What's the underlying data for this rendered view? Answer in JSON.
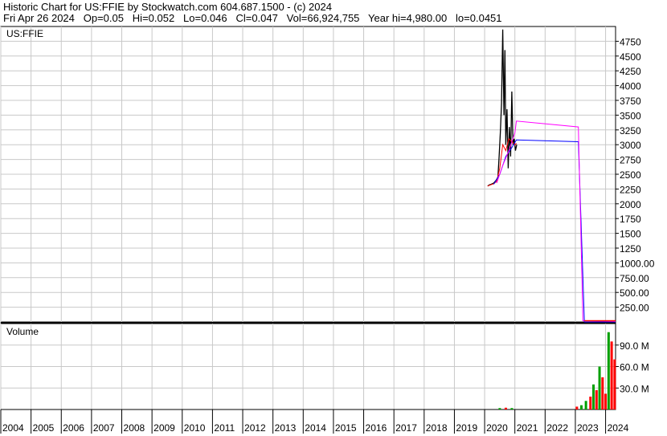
{
  "header": {
    "line1": "Historic Chart for US:FFIE by Stockwatch.com 604.687.1500 - (c) 2024",
    "line2": "Fri Apr 26 2024   Op=0.05   Hi=0.052   Lo=0.046   Cl=0.047   Vol=66,924,755   Year hi=4,980.00   lo=0.0451"
  },
  "chart_data": [
    {
      "type": "line",
      "title": "US:FFIE",
      "ylim": [
        0,
        5000
      ],
      "xlim": [
        2004,
        2024.33
      ],
      "y_ticks": [
        "250.00",
        "500.00",
        "750.00",
        "1000.00",
        "1250",
        "1500",
        "1750",
        "2000",
        "2250",
        "2500",
        "2750",
        "3000",
        "3250",
        "3500",
        "3750",
        "4000",
        "4250",
        "4500",
        "4750"
      ],
      "y_tick_values": [
        250,
        500,
        750,
        1000,
        1250,
        1500,
        1750,
        2000,
        2250,
        2500,
        2750,
        3000,
        3250,
        3500,
        3750,
        4000,
        4250,
        4500,
        4750
      ],
      "x_ticks": [
        "2004",
        "2005",
        "2006",
        "2007",
        "2008",
        "2009",
        "2010",
        "2011",
        "2012",
        "2013",
        "2014",
        "2015",
        "2016",
        "2017",
        "2018",
        "2019",
        "2020",
        "2021",
        "2022",
        "2023",
        "2024"
      ],
      "grid": true,
      "colors": {
        "price": "#000000",
        "ma_short": "#ff0000",
        "ma_mid": "#0000ff",
        "ma_long": "#ff00ff",
        "grid": "#c8c8c8"
      },
      "series": [
        {
          "color": "#000000",
          "x": [
            2020.1,
            2020.16,
            2020.22,
            2020.3,
            2020.38,
            2020.44,
            2020.48,
            2020.52,
            2020.56,
            2020.6,
            2020.64,
            2020.67,
            2020.7,
            2020.74,
            2020.78,
            2020.82,
            2020.86,
            2020.9,
            2020.94,
            2020.98,
            2021.02,
            2021.06
          ],
          "y": [
            2300,
            2320,
            2330,
            2350,
            2400,
            2450,
            2800,
            3200,
            3700,
            4950,
            3500,
            4600,
            3000,
            3600,
            2600,
            3300,
            2800,
            3900,
            3000,
            3100,
            2900,
            3000
          ]
        },
        {
          "color": "#ff0000",
          "x": [
            2020.1,
            2020.2,
            2020.3,
            2020.4,
            2020.5,
            2020.6,
            2020.7,
            2020.8,
            2020.9,
            2021.0,
            2021.06
          ],
          "y": [
            2300,
            2320,
            2340,
            2380,
            2600,
            3000,
            2900,
            3100,
            3050,
            3000,
            3020
          ]
        },
        {
          "color": "#0000ff",
          "x": [
            2020.3,
            2020.5,
            2020.7,
            2020.9,
            2021.05,
            2023.1,
            2023.3,
            2024.33
          ],
          "y": [
            2330,
            2500,
            2800,
            2950,
            3080,
            3050,
            0,
            0
          ]
        },
        {
          "color": "#ff00ff",
          "x": [
            2020.4,
            2020.6,
            2020.8,
            2021.0,
            2021.05,
            2023.1,
            2023.25,
            2024.33
          ],
          "y": [
            2350,
            2650,
            2900,
            3200,
            3400,
            3300,
            20,
            10
          ]
        }
      ]
    },
    {
      "type": "bar",
      "title": "Volume",
      "ylim": [
        0,
        120000000
      ],
      "y_ticks": [
        "30.0 M",
        "60.0 M",
        "90.0 M"
      ],
      "y_tick_values": [
        30000000,
        60000000,
        90000000
      ],
      "colors": {
        "up": "#00a000",
        "down": "#ff0000"
      },
      "x": [
        2020.5,
        2020.7,
        2020.9,
        2023.05,
        2023.2,
        2023.35,
        2023.5,
        2023.6,
        2023.7,
        2023.8,
        2023.9,
        2024.0,
        2024.1,
        2024.2,
        2024.3
      ],
      "values": [
        2000000,
        2500000,
        2000000,
        4000000,
        6000000,
        12000000,
        18000000,
        35000000,
        27000000,
        60000000,
        45000000,
        22000000,
        108000000,
        95000000,
        70000000
      ],
      "up": [
        true,
        false,
        true,
        false,
        true,
        true,
        false,
        true,
        false,
        true,
        false,
        false,
        true,
        false,
        false
      ]
    }
  ]
}
